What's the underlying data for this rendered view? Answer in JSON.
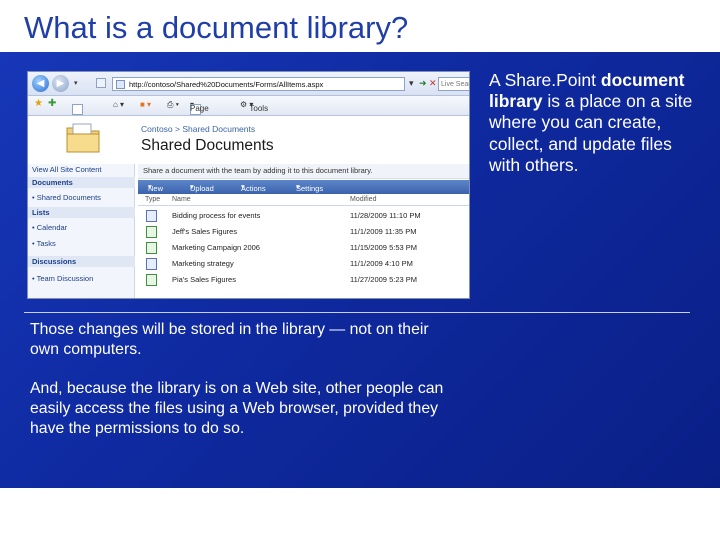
{
  "slide": {
    "title": "What is a document library?",
    "right_text": {
      "part1": "A Share.Point ",
      "bold": "document library",
      "part2": " is a place on a site where you can create, collect, and update files with others."
    },
    "para1": "Those changes will be stored in the library — not on their own computers.",
    "para2": "And, because the library is on a Web site, other people can easily access the files using a Web browser, provided they have the permissions to do so."
  },
  "screenshot": {
    "url": "http://contoso/Shared%20Documents/Forms/AllItems.aspx",
    "search_placeholder": "Live Search",
    "toolbar": {
      "page": "Page",
      "tools": "Tools"
    },
    "breadcrumb": "Contoso > Shared Documents",
    "library_title": "Shared Documents",
    "banner": "Share a document with the team by adding it to this document library.",
    "commands": [
      "New",
      "Upload",
      "Actions",
      "Settings"
    ],
    "columns": {
      "type": "Type",
      "name": "Name",
      "modified": "Modified"
    },
    "quicklaunch": {
      "view_all": "View All Site Content",
      "documents": "Documents",
      "shared_documents": "Shared Documents",
      "lists": "Lists",
      "calendar": "Calendar",
      "tasks": "Tasks",
      "discussions": "Discussions",
      "team_discussion": "Team Discussion"
    },
    "rows": [
      {
        "name": "Bidding process for events",
        "modified": "11/28/2009 11:10 PM",
        "type": "doc"
      },
      {
        "name": "Jeff's Sales Figures",
        "modified": "11/1/2009 11:35 PM",
        "type": "xls"
      },
      {
        "name": "Marketing Campaign 2006",
        "modified": "11/15/2009 5:53 PM",
        "type": "xls"
      },
      {
        "name": "Marketing strategy",
        "modified": "11/1/2009 4:10 PM",
        "type": "doc"
      },
      {
        "name": "Pia's Sales Figures",
        "modified": "11/27/2009 5:23 PM",
        "type": "xls"
      }
    ]
  },
  "colors": {
    "panel": "#1637b8",
    "title": "#1f3ea8",
    "command_bar": "#3a63ad"
  }
}
